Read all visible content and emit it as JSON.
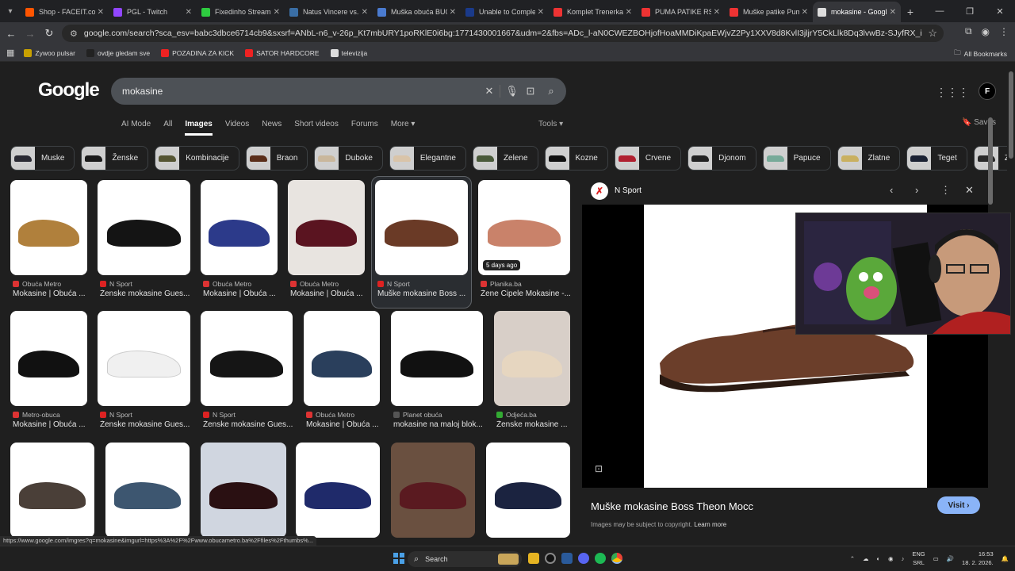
{
  "browser": {
    "tabs": [
      {
        "title": "Shop - FACEIT.com",
        "color": "#ff5500",
        "active": false
      },
      {
        "title": "PGL - Twitch",
        "color": "#9146ff",
        "active": false
      },
      {
        "title": "Fixedinho Stream",
        "color": "#2ecc40",
        "active": false
      },
      {
        "title": "Natus Vincere vs.",
        "color": "#3a6ea5",
        "active": false
      },
      {
        "title": "Muška obuća BUC",
        "color": "#4a7bd0",
        "active": false
      },
      {
        "title": "Unable to Comple",
        "color": "#1a3a8a",
        "active": false
      },
      {
        "title": "Komplet Trenerka",
        "color": "#e33",
        "active": false
      },
      {
        "title": "PUMA PATIKE RS",
        "color": "#e33",
        "active": false
      },
      {
        "title": "Muške patike Pum",
        "color": "#e33",
        "active": false
      },
      {
        "title": "mokasine - Googl",
        "color": "#ddd",
        "active": true
      }
    ],
    "url": "google.com/search?sca_esv=babc3dbce6714cb9&sxsrf=ANbL-n6_v-26p_Kt7mbURY1poRKlE0i6bg:1771430001667&udm=2&fbs=ADc_l-aN0CWEZBOHjofHoaMMDiKpaEWjvZ2Py1XXV8d8KvlI3jljrY5CkLlk8Dq3lvwBz-SJyfRX_inP-J3Cs9lQZu9JC8DiUG6qMRyS...",
    "bookmarks": [
      {
        "label": "Zywoo pulsar",
        "color": "#c9a100"
      },
      {
        "label": "ovdje gledam sve",
        "color": "#222"
      },
      {
        "label": "POZADINA ZA KICK",
        "color": "#e22"
      },
      {
        "label": "SATOR HARDCORE",
        "color": "#e22"
      },
      {
        "label": "televizija",
        "color": "#ddd"
      }
    ],
    "all_bookmarks": "All Bookmarks"
  },
  "google": {
    "logo": "Google",
    "query": "mokasine",
    "tabs": [
      "AI Mode",
      "All",
      "Images",
      "Videos",
      "News",
      "Short videos",
      "Forums",
      "More ▾"
    ],
    "active_tab": "Images",
    "tools": "Tools ▾",
    "saves": "Saves",
    "chips": [
      {
        "label": "Muske",
        "shoe": "#2a2a33"
      },
      {
        "label": "Ženske",
        "shoe": "#1a1a1a"
      },
      {
        "label": "Kombinacije",
        "shoe": "#553"
      },
      {
        "label": "Braon",
        "shoe": "#5a2e1a"
      },
      {
        "label": "Duboke",
        "shoe": "#c9b79c"
      },
      {
        "label": "Elegantne",
        "shoe": "#d9c4a9"
      },
      {
        "label": "Zelene",
        "shoe": "#4a5a3a"
      },
      {
        "label": "Kozne",
        "shoe": "#111"
      },
      {
        "label": "Crvene",
        "shoe": "#b02030"
      },
      {
        "label": "Djonom",
        "shoe": "#222"
      },
      {
        "label": "Papuce",
        "shoe": "#7a9"
      },
      {
        "label": "Zlatne",
        "shoe": "#c9b060"
      },
      {
        "label": "Teget",
        "shoe": "#1b2233"
      },
      {
        "label": "Zimske",
        "shoe": "#2a2a2a"
      }
    ],
    "results": [
      {
        "source": "Obuća Metro",
        "title": "Mokasine | Obuća ...",
        "srcColor": "#d33",
        "shoe": "#b0803c",
        "bg": "#ffffff"
      },
      {
        "source": "N Sport",
        "title": "Ženske mokasine Gues...",
        "srcColor": "#d22",
        "shoe": "#141414",
        "bg": "#ffffff"
      },
      {
        "source": "Obuća Metro",
        "title": "Mokasine | Obuća ...",
        "srcColor": "#d33",
        "shoe": "#2c3a8a",
        "bg": "#ffffff"
      },
      {
        "source": "Obuća Metro",
        "title": "Mokasine | Obuća ...",
        "srcColor": "#d33",
        "shoe": "#5a1420",
        "bg": "#e8e4e0"
      },
      {
        "source": "N Sport",
        "title": "Muške mokasine Boss ...",
        "srcColor": "#d22",
        "shoe": "#6a3a26",
        "bg": "#ffffff"
      },
      {
        "source": "Planika.ba",
        "title": "Žene Cipele Mokasine -...",
        "srcColor": "#d33",
        "shoe": "#c9826a",
        "bg": "#ffffff",
        "badge": "5 days ago"
      },
      {
        "source": "Metro-obuca",
        "title": "Mokasine | Obuća ...",
        "srcColor": "#d33",
        "shoe": "#111111",
        "bg": "#ffffff"
      },
      {
        "source": "N Sport",
        "title": "Ženske mokasine Gues...",
        "srcColor": "#d22",
        "shoe": "#f0f0f0",
        "bg": "#ffffff"
      },
      {
        "source": "N Sport",
        "title": "Ženske mokasine Gues...",
        "srcColor": "#d22",
        "shoe": "#151515",
        "bg": "#ffffff"
      },
      {
        "source": "Obuća Metro",
        "title": "Mokasine | Obuća ...",
        "srcColor": "#d33",
        "shoe": "#2a3f5c",
        "bg": "#ffffff"
      },
      {
        "source": "Planet obuća",
        "title": "mokasine na maloj blok...",
        "srcColor": "#555",
        "shoe": "#111111",
        "bg": "#ffffff"
      },
      {
        "source": "Odjeća.ba",
        "title": "Ženske mokasine ...",
        "srcColor": "#3a3",
        "shoe": "#e6d6c0",
        "bg": "#d8cfc8"
      },
      {
        "source": "",
        "title": "",
        "srcColor": "#555",
        "shoe": "#4a3f38",
        "bg": "#ffffff"
      },
      {
        "source": "",
        "title": "",
        "srcColor": "#555",
        "shoe": "#3d5670",
        "bg": "#ffffff"
      },
      {
        "source": "",
        "title": "",
        "srcColor": "#555",
        "shoe": "#2a1012",
        "bg": "#d0d6e0"
      },
      {
        "source": "",
        "title": "",
        "srcColor": "#555",
        "shoe": "#1f2a6a",
        "bg": "#ffffff"
      },
      {
        "source": "",
        "title": "",
        "srcColor": "#555",
        "shoe": "#5a1a20",
        "bg": "#6a5040"
      },
      {
        "source": "",
        "title": "",
        "srcColor": "#555",
        "shoe": "#1b2340",
        "bg": "#ffffff"
      }
    ],
    "panel": {
      "site": "N Sport",
      "title": "Muške mokasine Boss Theon Mocc",
      "visit": "Visit ›",
      "copyright": "Images may be subject to copyright.",
      "learn_more": "Learn more"
    }
  },
  "status_url": "https://www.google.com/imgres?q=mokasine&imgurl=https%3A%2F%2Fwww.obucametro.ba%2Ffiles%2Fthumbs%...",
  "taskbar": {
    "search": "Search",
    "lang1": "ENG",
    "lang2": "SRL",
    "time": "16:53",
    "date": "18. 2. 2026."
  }
}
